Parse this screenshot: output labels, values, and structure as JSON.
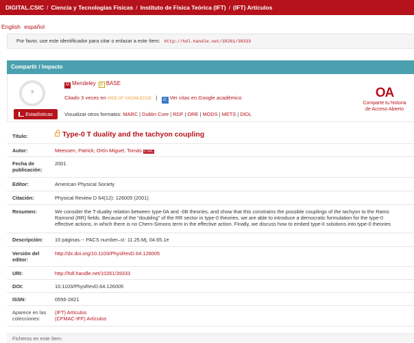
{
  "breadcrumb": {
    "items": [
      "DIGITAL.CSIC",
      "Ciencia y Tecnologías Físicas",
      "Instituto de Física Teórica (IFT)",
      "(IFT) Artículos"
    ],
    "separator": "/"
  },
  "languages": [
    "English",
    "español"
  ],
  "cite": {
    "text": "Por favor, use este identificador para citar o enlazar a este ítem:",
    "uri": "http://hdl.handle.net/10261/39333"
  },
  "share": {
    "header": "Compartir / Impacto",
    "ring_value": "?",
    "mendeley": "Mendeley",
    "base": "BASE",
    "cited_text": "Citado 3 veces en",
    "wok": "WEB OF KNOWLEDGE",
    "cited_sep": "|",
    "scholar": "Ver citas en Google académico",
    "stats_button": "Estadísticas",
    "formats_label": "Visualizar otros formatos:",
    "formats": [
      "MARC",
      "Dublin Core",
      "RDF",
      "ORE",
      "MODS",
      "METS",
      "DIDL"
    ],
    "oa_logo": "OA",
    "oa_caption": [
      "Comparte tu historia",
      "de Acceso Abierto"
    ]
  },
  "metadata": {
    "title_label": "Título:",
    "title": "Type-0 T duality and the tachyon coupling",
    "author_label": "Autor:",
    "authors": "Meessen, Patrick; Ortín Miguel, Tomás",
    "author_badge": "CSIC",
    "date_label": "Fecha de publicación:",
    "date": "2001",
    "editor_label": "Editor:",
    "editor": "American Physical Society",
    "citation_label": "Citación:",
    "citation": "Physical Review D 64(12): 126005 (2001)",
    "abstract_label": "Resumen:",
    "abstract": [
      "We consider the T-duality relation between type-0A and -0B theories, and show that this constrains the possible couplings of the tachyon to the Ramo",
      "Ramond (RR) fields. Because of the “doubling” of the RR sector in type-0 theories, we are able to introduce a democratic formulation for the type-0",
      "effective actions, in which there is no Chern-Simons term in the effective action. Finally, we discuss how to embed type-II solutions into type-0 theories"
    ],
    "description_label": "Descripción:",
    "description": "10 páginas.-- PACS number–s!: 11.25.Mj, 04.65.1e",
    "publisher_version_label": "Versión del editor:",
    "publisher_version": "http://dx.doi.org/10.1103/PhysRevD.64.126005",
    "uri_label": "URI:",
    "uri": "http://hdl.handle.net/10261/39333",
    "doi_label": "DOI:",
    "doi": "10.1103/PhysRevD.64.126005",
    "issn_label": "ISSN:",
    "issn": "0556-2821",
    "collections_label": "Aparece en las colecciones:",
    "collections": [
      "(IFT) Artículos",
      "(CFMAC-IFF) Artículos"
    ]
  },
  "footer": {
    "text": "Ficheros en este ítem:"
  },
  "colors": {
    "brand_red": "#b5121b",
    "share_teal": "#4aa0ae",
    "oa_orange": "#f29a1c"
  }
}
